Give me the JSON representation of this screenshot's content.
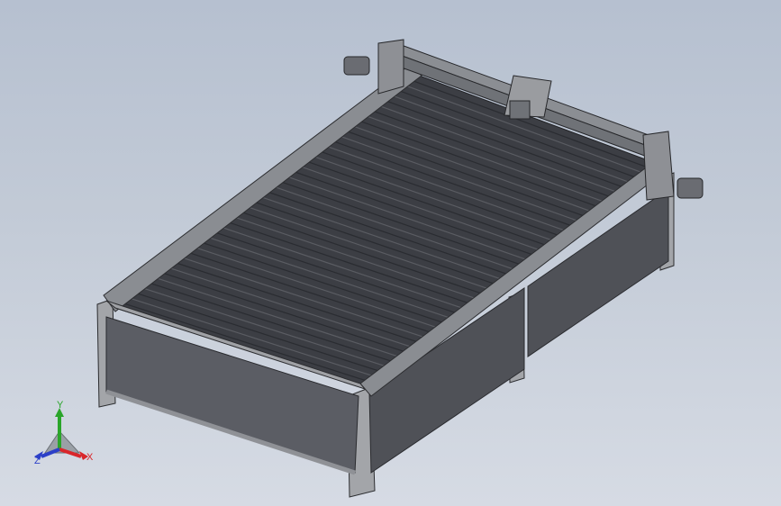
{
  "viewport": {
    "background_top": "#b6c0d0",
    "background_bottom": "#d6dbe4"
  },
  "model": {
    "frame_color": "#8a8d92",
    "slat_color": "#3c3e44",
    "panel_color": "#55575e",
    "leg_color": "#a3a5a9"
  },
  "triad": {
    "x_label": "X",
    "y_label": "Y",
    "z_label": "Z",
    "x_color": "#d9262b",
    "y_color": "#2aa52a",
    "z_color": "#2b3fc8"
  }
}
